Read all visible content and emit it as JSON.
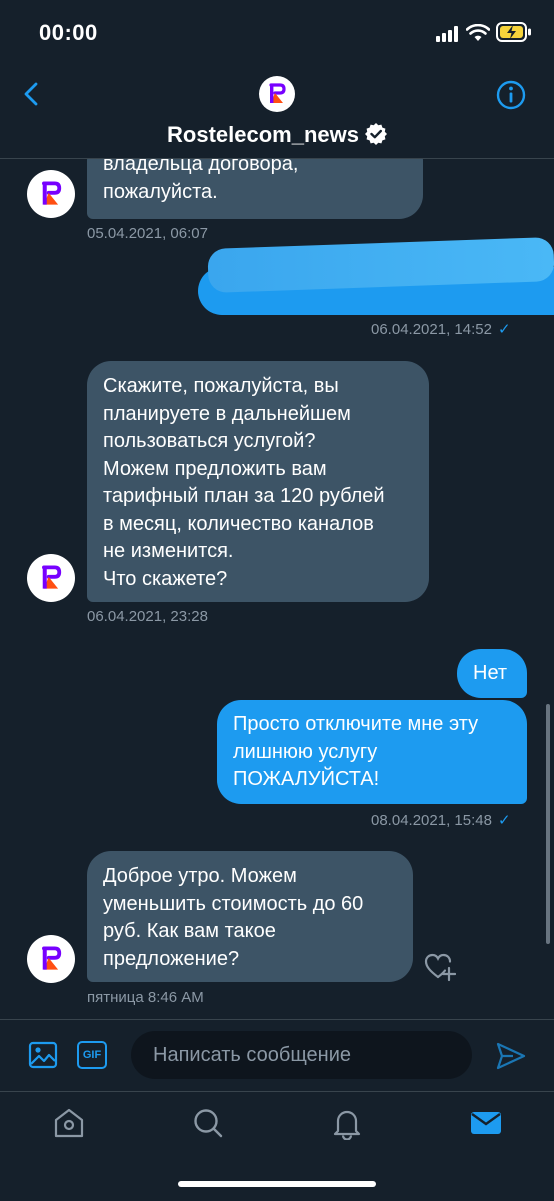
{
  "status_bar": {
    "time": "00:00"
  },
  "header": {
    "title": "Rostelecom_news"
  },
  "messages": [
    {
      "direction": "in",
      "lines": [
        "владельца договора,",
        "пожалуйста."
      ],
      "time": "05.04.2021, 06:07"
    },
    {
      "direction": "out",
      "redacted": true,
      "time": "06.04.2021, 14:52"
    },
    {
      "direction": "in",
      "lines": [
        "Скажите, пожалуйста, вы",
        "планируете в дальнейшем",
        "пользоваться услугой?",
        "Можем предложить вам",
        "тарифный план за 120 рублей",
        "в месяц, количество каналов",
        "не изменится.",
        "Что скажете?"
      ],
      "time": "06.04.2021, 23:28"
    },
    {
      "direction": "out",
      "lines": [
        "Нет"
      ]
    },
    {
      "direction": "out",
      "lines": [
        "Просто отключите мне эту",
        "лишнюю услугу",
        "ПОЖАЛУЙСТА!"
      ],
      "time": "08.04.2021, 15:48"
    },
    {
      "direction": "in",
      "lines": [
        "Доброе утро. Можем",
        "уменьшить стоимость до 60",
        "руб. Как вам такое",
        "предложение?"
      ],
      "time": "пятница 8:46 AM"
    }
  ],
  "composer": {
    "placeholder": "Написать сообщение",
    "gif_label": "GIF"
  },
  "colors": {
    "background": "#15202b",
    "incoming_bubble": "#3d5466",
    "outgoing_bubble": "#1d9bf0",
    "accent": "#1d9bf0",
    "muted": "#8b98a5"
  },
  "tabs": [
    "home-icon",
    "search-icon",
    "notifications-icon",
    "messages-icon"
  ]
}
